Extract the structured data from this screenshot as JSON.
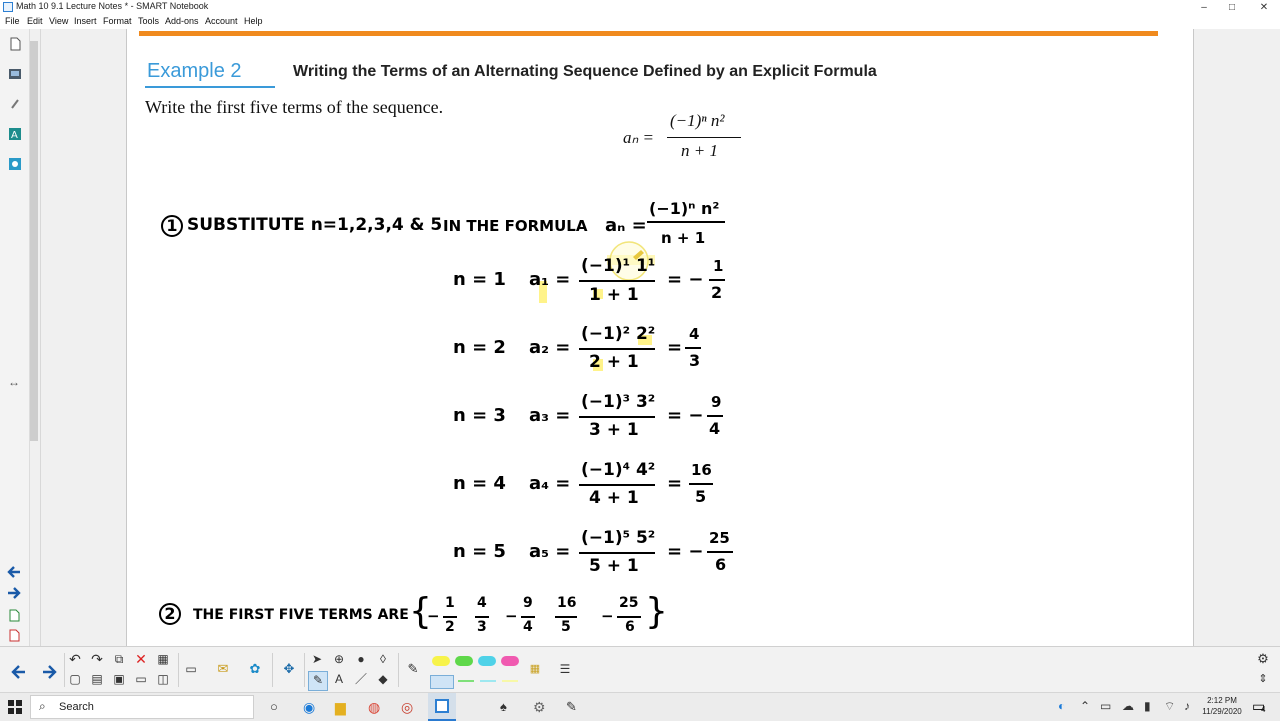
{
  "window": {
    "title": "Math 10 9.1 Lecture Notes * - SMART Notebook",
    "controls": {
      "minimize": "–",
      "maximize": "□",
      "close": "✕"
    }
  },
  "menu": [
    "File",
    "Edit",
    "View",
    "Insert",
    "Format",
    "Tools",
    "Add-ons",
    "Account",
    "Help"
  ],
  "slide": {
    "example_label": "Example 2",
    "example_title": "Writing the Terms of an Alternating Sequence Defined by an Explicit Formula",
    "instruction": "Write the first five terms of the sequence.",
    "formula": {
      "lhs": "aₙ =",
      "numerator": "(−1)ⁿ n²",
      "denominator": "n + 1"
    }
  },
  "notes": {
    "step1_number": "1",
    "step1_text": "SUBSTITUTE n=1,2,3,4 & 5",
    "step1_tail": "IN THE FORMULA",
    "step1_lhs": "aₙ =",
    "step1_num": "(−1)ⁿ n²",
    "step1_den": "n + 1",
    "rows": [
      {
        "n": "n = 1",
        "a": "a₁ =",
        "num": "(−1)¹ 1¹",
        "den": "1 + 1",
        "eq": "= −",
        "rnum": "1",
        "rden": "2"
      },
      {
        "n": "n = 2",
        "a": "a₂ =",
        "num": "(−1)² 2²",
        "den": "2 + 1",
        "eq": "=",
        "rnum": "4",
        "rden": "3"
      },
      {
        "n": "n = 3",
        "a": "a₃ =",
        "num": "(−1)³ 3²",
        "den": "3 + 1",
        "eq": "= −",
        "rnum": "9",
        "rden": "4"
      },
      {
        "n": "n = 4",
        "a": "a₄ =",
        "num": "(−1)⁴ 4²",
        "den": "4 + 1",
        "eq": "=",
        "rnum": "16",
        "rden": "5"
      },
      {
        "n": "n = 5",
        "a": "a₅ =",
        "num": "(−1)⁵ 5²",
        "den": "5 + 1",
        "eq": "= −",
        "rnum": "25",
        "rden": "6"
      }
    ],
    "step2_number": "2",
    "step2_text": "THE FIRST FIVE TERMS ARE",
    "terms": {
      "open": "{",
      "close": "}",
      "items": [
        {
          "sign": "−",
          "num": "1",
          "den": "2"
        },
        {
          "sign": "",
          "num": "4",
          "den": "3"
        },
        {
          "sign": "−",
          "num": "9",
          "den": "4"
        },
        {
          "sign": "",
          "num": "16",
          "den": "5"
        },
        {
          "sign": "−",
          "num": "25",
          "den": "6"
        }
      ]
    }
  },
  "taskbar": {
    "search_label": "Search",
    "time": "2:12 PM",
    "date": "11/29/2020",
    "notification_count": "4"
  },
  "colors": {
    "accent_orange": "#f08a1e",
    "example_blue": "#3a9ad9",
    "highlighter": "#fff38a",
    "pen_yellow": "#f7f34a",
    "pen_green": "#5fd84a",
    "pen_cyan": "#4fd2e8",
    "pen_pink": "#f05ab0"
  }
}
